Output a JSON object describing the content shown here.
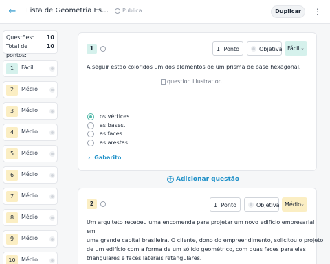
{
  "header": {
    "back_icon": "arrow-left-icon",
    "title": "Lista de Geometria Espacial",
    "visibility": "Publica",
    "duplicate_label": "Duplicar",
    "more_icon": "kebab-icon"
  },
  "summary": {
    "questions_label": "Questões:",
    "questions_value": "10",
    "points_label": "Total de pontos:",
    "points_value": "10"
  },
  "question_list": [
    {
      "number": "1",
      "difficulty": "Fácil"
    },
    {
      "number": "2",
      "difficulty": "Médio"
    },
    {
      "number": "3",
      "difficulty": "Médio"
    },
    {
      "number": "4",
      "difficulty": "Médio"
    },
    {
      "number": "5",
      "difficulty": "Médio"
    },
    {
      "number": "6",
      "difficulty": "Médio"
    },
    {
      "number": "7",
      "difficulty": "Médio"
    },
    {
      "number": "8",
      "difficulty": "Médio"
    },
    {
      "number": "9",
      "difficulty": "Médio"
    },
    {
      "number": "10",
      "difficulty": "Médio"
    }
  ],
  "q1": {
    "number": "1",
    "points_value": "1",
    "points_unit": "Ponto",
    "type": "Objetiva",
    "difficulty": "Fácil",
    "stem": "A seguir estão coloridos um dos elementos de um prisma de base hexagonal.",
    "image_alt": "question illustration",
    "options": [
      "os vértices.",
      "as bases.",
      "as faces.",
      "as arestas."
    ],
    "selected_option": 0,
    "answer_key_label": "Gabarito"
  },
  "add_question_label": "Adicionar questão",
  "q2": {
    "number": "2",
    "points_value": "1",
    "points_unit": "Ponto",
    "type": "Objetiva",
    "difficulty": "Médio",
    "stem_lines": [
      "Um arquiteto recebeu uma encomenda para projetar um novo edifício empresarial",
      "em",
      "uma grande capital brasileira. O cliente, dono do empreendimento, solicitou o projeto",
      "de um edifício com a forma de um sólido geométrico, com duas faces paralelas",
      "triangulares e faces laterais retangulares."
    ]
  },
  "colors": {
    "accent": "#1e90c8",
    "easy": "#d5f1ec",
    "medium": "#fbeec3",
    "selected_radio": "#4fb8a8"
  }
}
